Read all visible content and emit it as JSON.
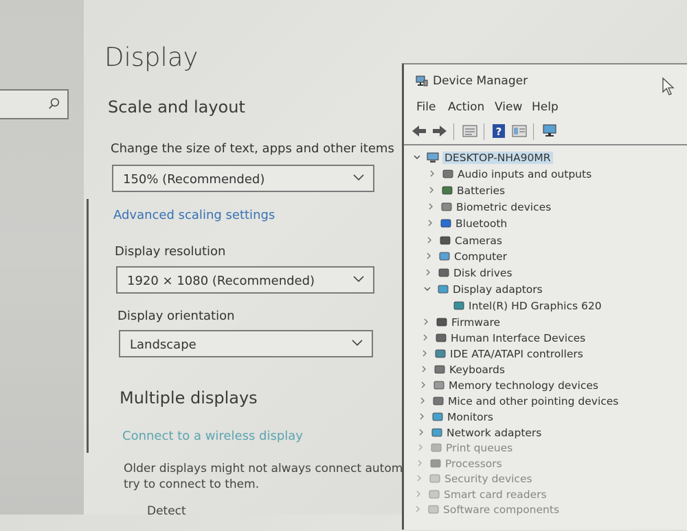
{
  "settings": {
    "page_title": "Display",
    "scale_section": "Scale and layout",
    "change_size_label": "Change the size of text, apps and other items",
    "scale_value": "150% (Recommended)",
    "advanced_link": "Advanced scaling settings",
    "resolution_label": "Display resolution",
    "resolution_value": "1920 × 1080 (Recommended)",
    "orientation_label": "Display orientation",
    "orientation_value": "Landscape",
    "multi_section": "Multiple displays",
    "wireless_link": "Connect to a wireless display",
    "older_line1": "Older displays might not always connect automatic",
    "older_line2": "try to connect to them.",
    "detect_label": "Detect"
  },
  "device_manager": {
    "title": "Device Manager",
    "menu": [
      "File",
      "Action",
      "View",
      "Help"
    ],
    "root": "DESKTOP-NHA90MR",
    "items": [
      {
        "label": "Audio inputs and outputs",
        "icon": "speaker-icon"
      },
      {
        "label": "Batteries",
        "icon": "battery-icon"
      },
      {
        "label": "Biometric devices",
        "icon": "fingerprint-icon"
      },
      {
        "label": "Bluetooth",
        "icon": "bluetooth-icon"
      },
      {
        "label": "Cameras",
        "icon": "camera-icon"
      },
      {
        "label": "Computer",
        "icon": "computer-icon"
      },
      {
        "label": "Disk drives",
        "icon": "disk-icon"
      },
      {
        "label": "Display adaptors",
        "icon": "monitor-icon"
      },
      {
        "label": "Intel(R) HD Graphics 620",
        "icon": "display-adapter-icon"
      },
      {
        "label": "Firmware",
        "icon": "chip-icon"
      },
      {
        "label": "Human Interface Devices",
        "icon": "hid-icon"
      },
      {
        "label": "IDE ATA/ATAPI controllers",
        "icon": "ide-icon"
      },
      {
        "label": "Keyboards",
        "icon": "keyboard-icon"
      },
      {
        "label": "Memory technology devices",
        "icon": "memory-icon"
      },
      {
        "label": "Mice and other pointing devices",
        "icon": "mouse-icon"
      },
      {
        "label": "Monitors",
        "icon": "monitor-icon"
      },
      {
        "label": "Network adapters",
        "icon": "network-icon"
      },
      {
        "label": "Print queues",
        "icon": "printer-icon"
      },
      {
        "label": "Processors",
        "icon": "processor-icon"
      },
      {
        "label": "Security devices",
        "icon": "security-icon"
      },
      {
        "label": "Smart card readers",
        "icon": "smartcard-icon"
      },
      {
        "label": "Software components",
        "icon": "software-icon"
      }
    ]
  },
  "colors": {
    "link": "#3672b4",
    "selection": "#c7dcea"
  }
}
